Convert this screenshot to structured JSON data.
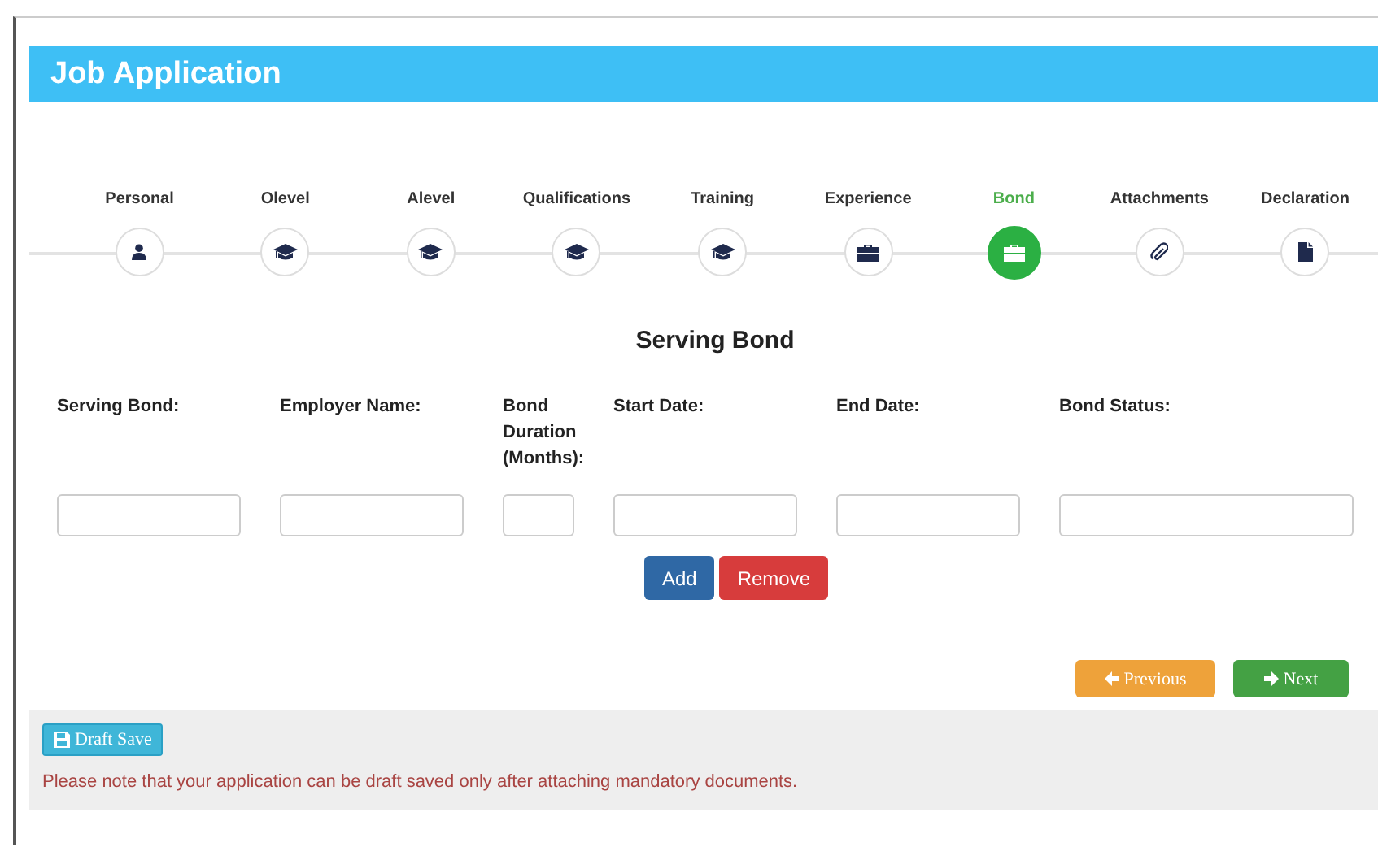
{
  "header": {
    "title": "Job Application"
  },
  "steps": [
    {
      "label": "Personal",
      "kind": "person",
      "selected": false
    },
    {
      "label": "Olevel",
      "kind": "cap",
      "selected": false
    },
    {
      "label": "Alevel",
      "kind": "cap",
      "selected": false
    },
    {
      "label": "Qualifications",
      "kind": "cap",
      "selected": false
    },
    {
      "label": "Training",
      "kind": "cap",
      "selected": false
    },
    {
      "label": "Experience",
      "kind": "case",
      "selected": false
    },
    {
      "label": "Bond",
      "kind": "case",
      "selected": true
    },
    {
      "label": "Attachments",
      "kind": "clip",
      "selected": false
    },
    {
      "label": "Declaration",
      "kind": "file",
      "selected": false
    }
  ],
  "section_title": "Serving Bond",
  "fields": [
    {
      "label": "Serving Bond:",
      "kind": "normal"
    },
    {
      "label": "Employer Name:",
      "kind": "normal"
    },
    {
      "label": "Bond Duration (Months):",
      "kind": "small"
    },
    {
      "label": "Start Date:",
      "kind": "normal"
    },
    {
      "label": "End Date:",
      "kind": "normal"
    },
    {
      "label": "Bond Status:",
      "kind": "wide"
    }
  ],
  "row_buttons": [
    {
      "label": "Add",
      "kind": "primary"
    },
    {
      "label": "Remove",
      "kind": "danger"
    }
  ],
  "nav_buttons": [
    {
      "label": "Previous",
      "kind": "previous"
    },
    {
      "label": "Next",
      "kind": "next"
    }
  ],
  "footer": {
    "draft_button": "Draft Save",
    "note": "Please note that your application can be draft saved only after attaching mandatory documents."
  }
}
